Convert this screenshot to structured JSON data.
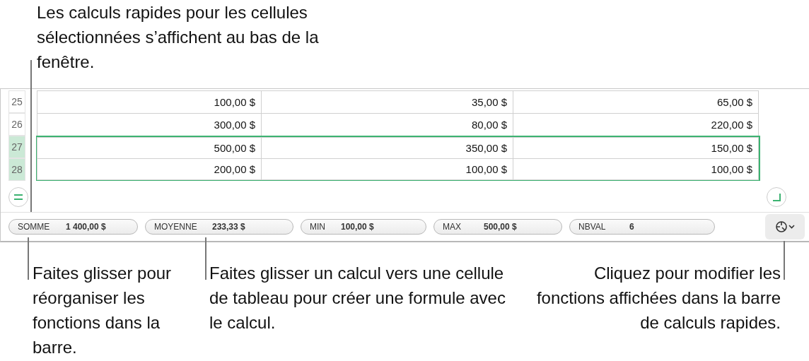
{
  "top_callout": "Les calculs rapides pour les cellules sélectionnées s’affichent au bas de la fenêtre.",
  "table": {
    "rows": [
      {
        "number": "25",
        "selected": false,
        "cells": [
          "100,00 $",
          "35,00 $",
          "65,00 $"
        ]
      },
      {
        "number": "26",
        "selected": false,
        "cells": [
          "300,00 $",
          "80,00 $",
          "220,00 $"
        ]
      },
      {
        "number": "27",
        "selected": true,
        "cells": [
          "500,00 $",
          "350,00 $",
          "150,00 $"
        ]
      },
      {
        "number": "28",
        "selected": true,
        "cells": [
          "200,00 $",
          "100,00 $",
          "100,00 $"
        ]
      }
    ]
  },
  "quick_calcs": [
    {
      "label": "SOMME",
      "value": "1 400,00 $"
    },
    {
      "label": "MOYENNE",
      "value": "233,33 $"
    },
    {
      "label": "MIN",
      "value": "100,00 $"
    },
    {
      "label": "MAX",
      "value": "500,00 $"
    },
    {
      "label": "NBVAL",
      "value": "6"
    }
  ],
  "callouts": [
    {
      "kind": "left",
      "text": "Faites glisser pour réorganiser les fonctions dans la barre."
    },
    {
      "kind": "middle",
      "text": "Faites glisser un calcul vers une cellule de tableau pour créer une formule avec le calcul."
    },
    {
      "kind": "right",
      "text": "Cliquez pour modifier les fonctions affichées dans la barre de calculs rapides."
    }
  ]
}
